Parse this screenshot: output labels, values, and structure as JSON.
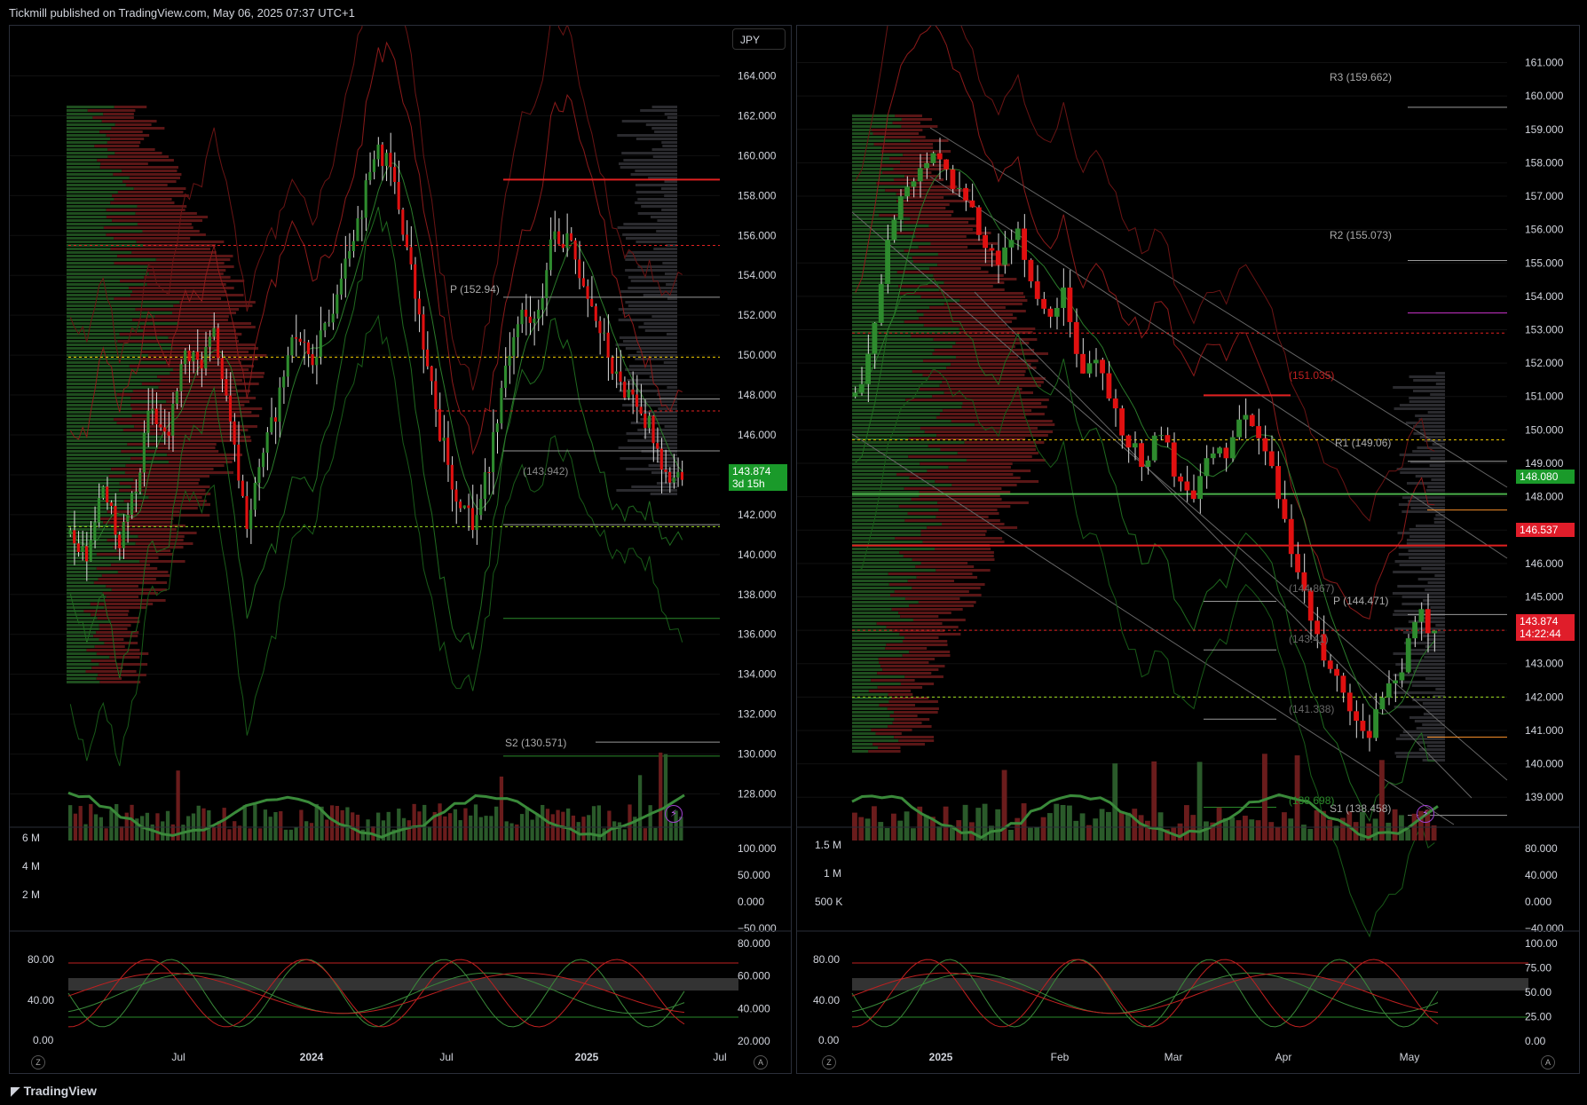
{
  "header": {
    "text": "Tickmill published on TradingView.com, May 06, 2025 07:37 UTC+1"
  },
  "footer": {
    "brand": "TradingView"
  },
  "left": {
    "currency_button": "JPY",
    "price_axis": [
      "164.000",
      "162.000",
      "160.000",
      "158.000",
      "156.000",
      "154.000",
      "152.000",
      "150.000",
      "148.000",
      "146.000",
      "144.000",
      "142.000",
      "140.000",
      "138.000",
      "136.000",
      "134.000",
      "132.000",
      "130.000",
      "128.000"
    ],
    "price_tag": "143.874",
    "price_tag_sub": "3d 15h",
    "pivot_labels": {
      "p": "P (152.94)",
      "mid": "(143.942)",
      "s2": "S2 (130.571)"
    },
    "time_axis": [
      "Jul",
      "2024",
      "Jul",
      "2025",
      "Jul"
    ],
    "volume_axis_left": [
      "6 M",
      "4 M",
      "2 M"
    ],
    "volume_axis_right": [
      "100.000",
      "50.000",
      "0.000",
      "−50.000"
    ],
    "osc_axis_left": [
      "80.00",
      "40.00",
      "0.00"
    ],
    "osc_axis_right": [
      "80.000",
      "60.000",
      "40.000",
      "20.000"
    ],
    "corner_z": "Z",
    "corner_a": "A"
  },
  "right": {
    "price_axis": [
      "161.000",
      "160.000",
      "159.000",
      "158.000",
      "157.000",
      "156.000",
      "155.000",
      "154.000",
      "153.000",
      "152.000",
      "151.000",
      "150.000",
      "149.000",
      "148.000",
      "147.000",
      "146.000",
      "145.000",
      "144.000",
      "143.000",
      "142.000",
      "141.000",
      "140.000",
      "139.000"
    ],
    "price_tag_green": "148.080",
    "price_tag_red": "146.537",
    "price_tag": "143.874",
    "price_tag_sub": "14:22:44",
    "pivot_labels": {
      "r3": "R3 (159.662)",
      "r2": "R2 (155.073)",
      "r1": "R1 (149.06)",
      "p": "P (144.471)",
      "s1": "S1 (138.458)",
      "red": "(151.035)",
      "g1": "(144.867)",
      "g2": "(143.41)",
      "g3": "(141.338)",
      "g4": "(138.698)"
    },
    "time_axis": [
      "2025",
      "Feb",
      "Mar",
      "Apr",
      "May"
    ],
    "volume_axis_left": [
      "1.5 M",
      "1 M",
      "500 K"
    ],
    "volume_axis_right": [
      "80.000",
      "40.000",
      "0.000",
      "−40.000"
    ],
    "osc_axis_left": [
      "80.00",
      "40.00",
      "0.00"
    ],
    "osc_axis_right": [
      "100.00",
      "75.00",
      "50.00",
      "25.00",
      "0.00"
    ],
    "corner_z": "Z",
    "corner_a": "A"
  },
  "colors": {
    "up": "#2e8b2e",
    "down": "#e01010",
    "bg": "#000000",
    "grid": "#1a1a1a",
    "yellow": "#f5d000",
    "orange": "#f28c28",
    "purple": "#cc33cc"
  },
  "chart_data": [
    {
      "type": "candlestick",
      "title": "",
      "symbol_currency": "JPY",
      "x_ticks": [
        "Jul",
        "2024",
        "Jul",
        "2025",
        "Jul"
      ],
      "ylim": [
        127,
        165
      ],
      "last_price": 143.874,
      "close_path": [
        141.0,
        139.5,
        143.5,
        140.5,
        143.0,
        147.5,
        145.5,
        150.0,
        149.5,
        151.0,
        146.0,
        141.5,
        145.0,
        148.0,
        151.0,
        150.0,
        151.5,
        155.0,
        157.0,
        160.5,
        159.0,
        155.0,
        150.0,
        146.0,
        143.0,
        141.5,
        144.5,
        149.5,
        152.0,
        151.5,
        156.5,
        155.5,
        153.5,
        151.0,
        148.5,
        148.0,
        146.5,
        144.0,
        143.874
      ],
      "horizontal_levels": [
        158.8,
        155.5,
        152.9,
        149.9,
        147.8,
        147.2,
        145.2,
        141.5,
        141.4,
        136.8,
        130.6,
        129.9
      ],
      "pivot_labels": [
        "P (152.94)",
        "(143.942)",
        "S2 (130.571)"
      ]
    },
    {
      "type": "candlestick",
      "title": "",
      "x_ticks": [
        "2025",
        "Feb",
        "Mar",
        "Apr",
        "May"
      ],
      "ylim": [
        138.5,
        161.2
      ],
      "last_price": 143.874,
      "close_path": [
        151.0,
        152.5,
        155.5,
        157.0,
        157.8,
        158.2,
        157.5,
        157.0,
        155.5,
        155.0,
        156.0,
        154.5,
        153.5,
        154.0,
        151.5,
        152.0,
        151.0,
        149.5,
        149.0,
        150.0,
        148.5,
        148.0,
        149.5,
        149.0,
        150.5,
        150.0,
        148.5,
        146.5,
        145.0,
        143.5,
        142.5,
        141.5,
        141.0,
        142.5,
        143.0,
        144.5,
        143.874
      ],
      "horizontal_levels": [
        159.662,
        155.073,
        153.5,
        152.9,
        151.035,
        149.7,
        149.06,
        148.08,
        147.6,
        146.537,
        144.867,
        144.471,
        144.0,
        143.41,
        142.0,
        141.338,
        140.8,
        138.698,
        138.458
      ],
      "pivot_labels": [
        "R3 (159.662)",
        "R2 (155.073)",
        "R1 (149.06)",
        "P (144.471)",
        "S1 (138.458)",
        "(151.035)",
        "(144.867)",
        "(143.41)",
        "(141.338)",
        "(138.698)"
      ]
    }
  ]
}
